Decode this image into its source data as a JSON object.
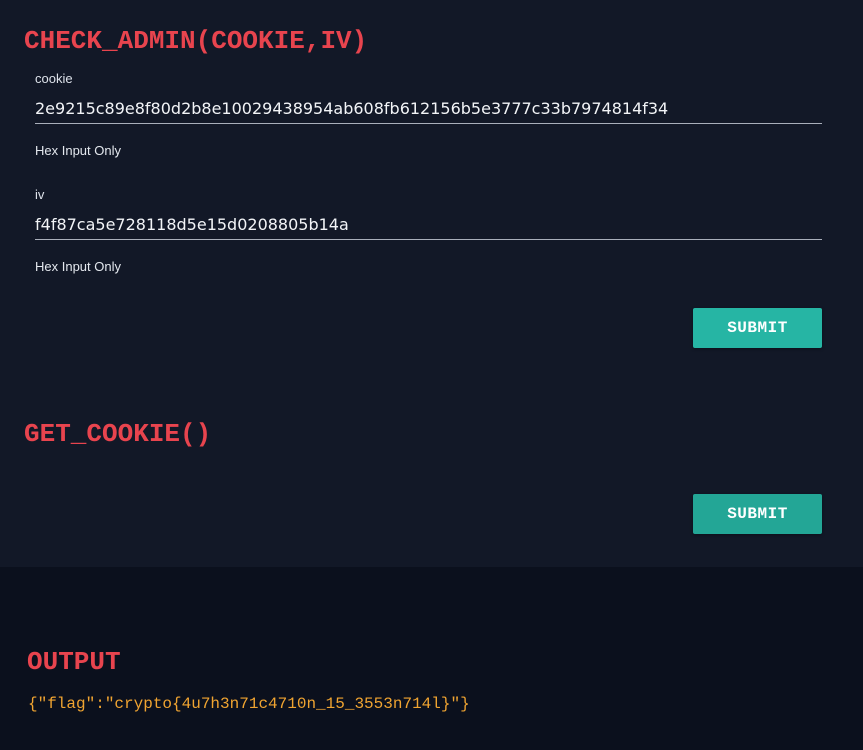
{
  "check_admin": {
    "title": "CHECK_ADMIN(COOKIE,IV)",
    "cookie": {
      "label": "cookie",
      "value": "2e9215c89e8f80d2b8e10029438954ab608fb612156b5e3777c33b7974814f34",
      "helper": "Hex Input Only"
    },
    "iv": {
      "label": "iv",
      "value": "f4f87ca5e728118d5e15d0208805b14a",
      "helper": "Hex Input Only"
    },
    "submit_label": "SUBMIT"
  },
  "get_cookie": {
    "title": "GET_COOKIE()",
    "submit_label": "SUBMIT"
  },
  "output": {
    "title": "OUTPUT",
    "text": "{\"flag\":\"crypto{4u7h3n71c4710n_15_3553n714l}\"}"
  },
  "colors": {
    "accent_red": "#e8444e",
    "button_teal": "#26b5a4",
    "output_orange": "#f0a431",
    "panel_bg": "#121827",
    "page_bg": "#0b101d"
  }
}
